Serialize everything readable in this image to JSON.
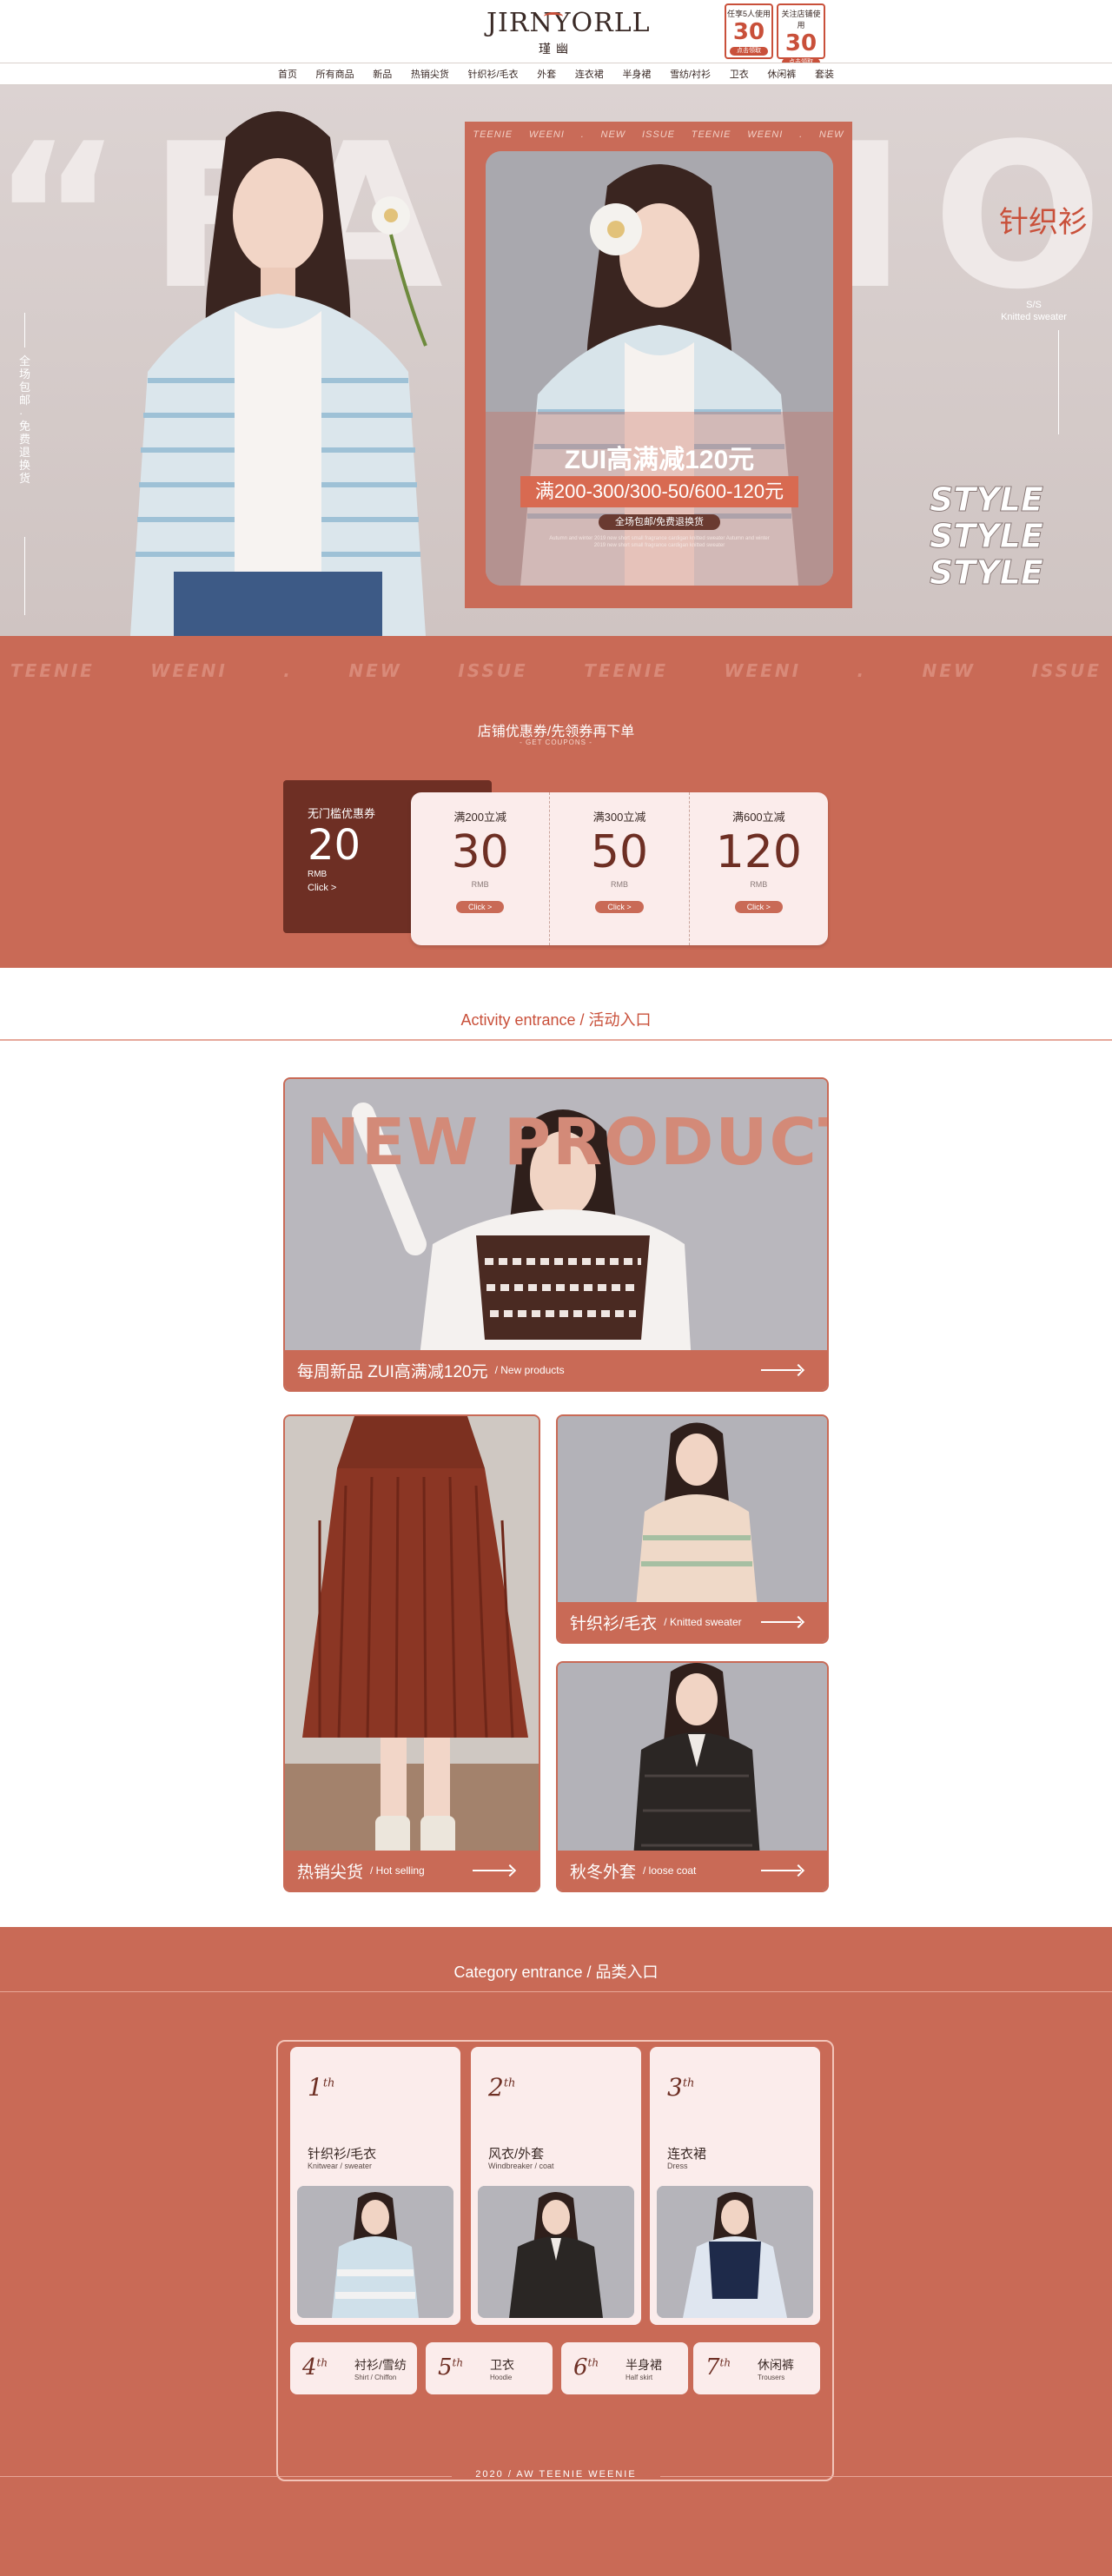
{
  "brand": {
    "logo": "JIRNYORLL",
    "sub": "瑾幽"
  },
  "badges": [
    {
      "top": "任享5人使用",
      "num": "30",
      "bottom": "点击领取"
    },
    {
      "top": "关注店铺使用",
      "num": "30",
      "bottom": "点击领取"
    }
  ],
  "nav": [
    "首页",
    "所有商品",
    "新品",
    "热销尖货",
    "针织衫/毛衣",
    "外套",
    "连衣裙",
    "半身裙",
    "雪纺/衬衫",
    "卫衣",
    "休闲裤",
    "套装"
  ],
  "hero": {
    "big_text": "“FASHION”",
    "side_text": "全场包邮·免费退换货",
    "band": [
      "TEENIE",
      "WEENI",
      ".",
      "NEW",
      "ISSUE",
      "TEENIE",
      "WEENI",
      ".",
      "NEW"
    ],
    "poster_title": "ZUI高满减120元",
    "poster_bar": "满200-300/300-50/600-120元",
    "poster_sub": "全场包邮/免费退换货",
    "poster_tiny": "Autumn and winter 2019 new short small fragrance cardigan knitted sweater Autumn and winter 2019 new short small fragrance cardigan knitted sweater",
    "category": "针织衫",
    "ss": "S/S",
    "ss_en": "Knitted sweater",
    "style_words": [
      "STYLE",
      "STYLE",
      "STYLE"
    ]
  },
  "coupons": {
    "marquee": [
      "TEENIE",
      "WEENI",
      ".",
      "NEW",
      "ISSUE",
      "TEENIE",
      "WEENI",
      ".",
      "NEW",
      "ISSUE"
    ],
    "title": "店铺优惠券/先领券再下单",
    "subtitle": "- GET COUPONS -",
    "free": {
      "label": "无门槛优惠券",
      "amount": "20",
      "rmb": "RMB",
      "click": "Click >"
    },
    "items": [
      {
        "label": "满200立减",
        "amount": "30",
        "rmb": "RMB",
        "click": "Click >"
      },
      {
        "label": "满300立减",
        "amount": "50",
        "rmb": "RMB",
        "click": "Click >"
      },
      {
        "label": "满600立减",
        "amount": "120",
        "rmb": "RMB",
        "click": "Click >"
      }
    ]
  },
  "activity": {
    "title": "Activity entrance / 活动入口",
    "new_products_text": "NEW PRODUCTS",
    "tiles": {
      "new": {
        "zh": "每周新品 ZUI高满减120元",
        "en": "/ New products"
      },
      "hot": {
        "zh": "热销尖货",
        "en": "/ Hot selling"
      },
      "knit": {
        "zh": "针织衫/毛衣",
        "en": "/ Knitted sweater"
      },
      "coat": {
        "zh": "秋冬外套",
        "en": "/ loose coat"
      }
    }
  },
  "category": {
    "title": "Category entrance / 品类入口",
    "cards": [
      {
        "rank": "1",
        "suffix": "th",
        "zh": "针织衫/毛衣",
        "en": "Knitwear / sweater"
      },
      {
        "rank": "2",
        "suffix": "th",
        "zh": "风衣/外套",
        "en": "Windbreaker / coat"
      },
      {
        "rank": "3",
        "suffix": "th",
        "zh": "连衣裙",
        "en": "Dress"
      }
    ],
    "minis": [
      {
        "rank": "4",
        "suffix": "th",
        "zh": "衬衫/雪纺",
        "en": "Shirt / Chiffon"
      },
      {
        "rank": "5",
        "suffix": "th",
        "zh": "卫衣",
        "en": "Hoodie"
      },
      {
        "rank": "6",
        "suffix": "th",
        "zh": "半身裙",
        "en": "Half skirt"
      },
      {
        "rank": "7",
        "suffix": "th",
        "zh": "休闲裤",
        "en": "Trousers"
      }
    ],
    "footer": "2020 / AW TEENIE WEENIE"
  }
}
